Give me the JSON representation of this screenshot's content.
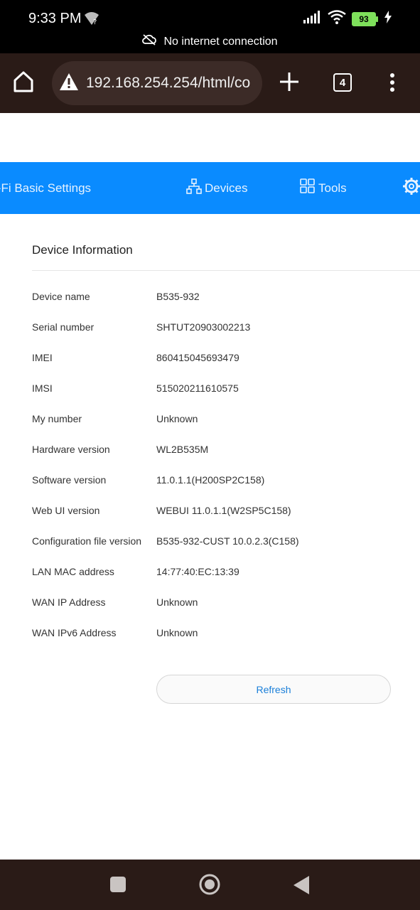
{
  "status_bar": {
    "time": "9:33 PM",
    "battery_level": "93",
    "network_notice": "No internet connection",
    "icons": [
      "wifi-question-icon",
      "signal-icon",
      "wifi-icon",
      "battery-icon",
      "charging-icon",
      "cloud-off-icon"
    ]
  },
  "browser": {
    "url": "192.168.254.254/html/co",
    "tab_count": "4",
    "icons": [
      "home-icon",
      "warning-icon",
      "plus-icon",
      "tabs-icon",
      "more-vert-icon"
    ]
  },
  "nav": {
    "items": [
      {
        "label": "i-Fi Basic Settings"
      },
      {
        "label": "Devices",
        "icon": "network-icon"
      },
      {
        "label": "Tools",
        "icon": "grid-icon"
      },
      {
        "label": "",
        "icon": "gear-icon"
      }
    ]
  },
  "device_info": {
    "title": "Device Information",
    "rows": [
      {
        "label": "Device name",
        "value": "B535-932"
      },
      {
        "label": "Serial number",
        "value": "SHTUT20903002213"
      },
      {
        "label": "IMEI",
        "value": "860415045693479"
      },
      {
        "label": "IMSI",
        "value": "515020211610575"
      },
      {
        "label": "My number",
        "value": "Unknown"
      },
      {
        "label": "Hardware version",
        "value": "WL2B535M"
      },
      {
        "label": "Software version",
        "value": "11.0.1.1(H200SP2C158)"
      },
      {
        "label": "Web UI version",
        "value": "WEBUI 11.0.1.1(W2SP5C158)"
      },
      {
        "label": "Configuration file version",
        "value": "B535-932-CUST 10.0.2.3(C158)"
      },
      {
        "label": "LAN MAC address",
        "value": "14:77:40:EC:13:39"
      },
      {
        "label": "WAN IP Address",
        "value": "Unknown"
      },
      {
        "label": "WAN IPv6 Address",
        "value": "Unknown"
      }
    ],
    "refresh_label": "Refresh"
  },
  "system_nav": {
    "icons": [
      "recents-icon",
      "home-circle-icon",
      "back-icon"
    ]
  },
  "colors": {
    "nav_blue": "#0a8bff",
    "browser_bar": "#2a1b17",
    "refresh_text": "#1a7fd9"
  }
}
